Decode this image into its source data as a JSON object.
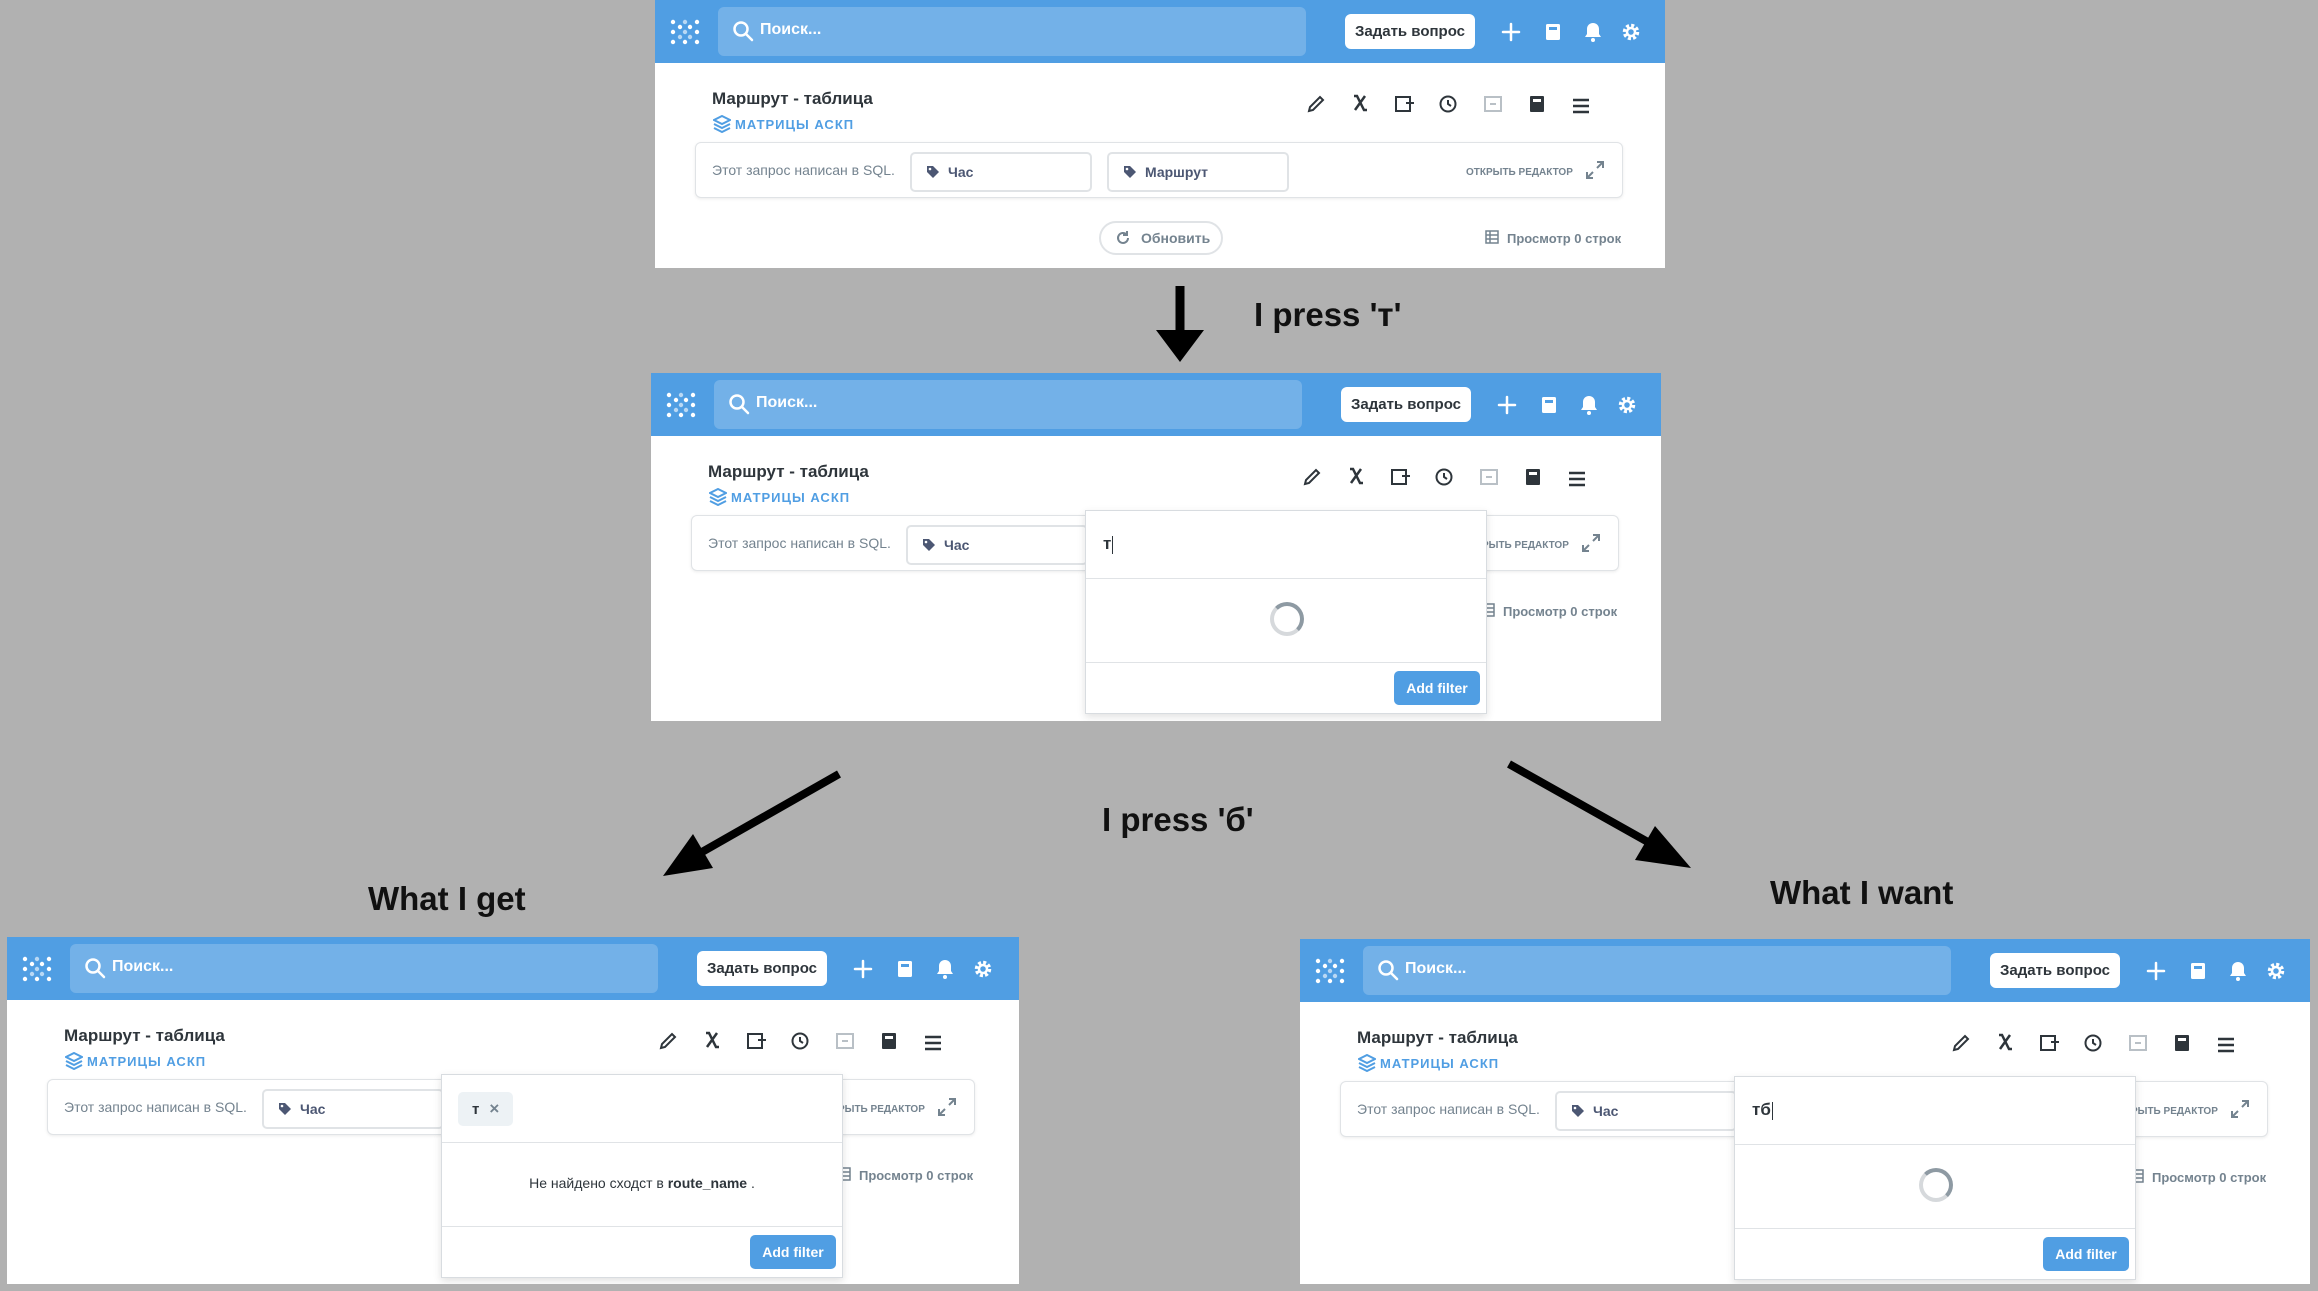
{
  "ui": {
    "search_placeholder": "Поиск...",
    "ask_button": "Задать вопрос",
    "title": "Маршрут - таблица",
    "collection": "МАТРИЦЫ АСКП",
    "sql_note": "Этот запрос написан в SQL.",
    "param_hour": "Час",
    "param_route": "Маршрут",
    "open_editor": "ОТКРЫТЬ РЕДАКТОР",
    "refresh": "Обновить",
    "rows": "Просмотр 0 строк",
    "add_filter": "Add filter"
  },
  "states": {
    "step2_typed": "т",
    "got_token": "т",
    "got_message_prefix": "Не найдено сходст в ",
    "got_message_field": "route_name",
    "got_message_suffix": " .",
    "want_typed": "тб"
  },
  "annotations": {
    "press_t": "I press 'т'",
    "press_b": "I press 'б'",
    "what_i_get": "What I get",
    "what_i_want": "What I want"
  },
  "colors": {
    "brand": "#509ee3",
    "background": "#b1b1b1",
    "text_dark": "#2e353b",
    "text_muted": "#74838f"
  },
  "icons": [
    "metabase-logo-icon",
    "search-icon",
    "plus-icon",
    "collection-icon",
    "bell-icon",
    "gear-icon",
    "pencil-icon",
    "variable-x-icon",
    "snippet-icon",
    "history-icon",
    "data-reference-icon",
    "book-icon",
    "menu-icon",
    "tag-icon",
    "expand-icon",
    "refresh-icon",
    "table-icon",
    "layers-icon"
  ]
}
